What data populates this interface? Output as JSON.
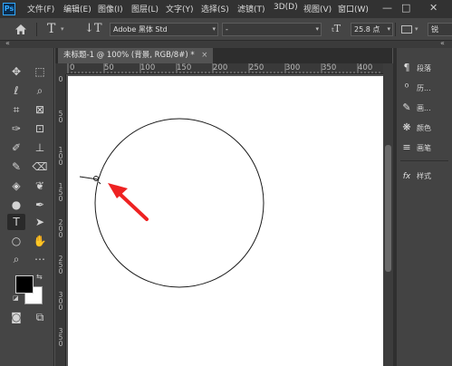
{
  "app": {
    "logo": "Ps"
  },
  "menu": [
    "文件(F)",
    "编辑(E)",
    "图像(I)",
    "图层(L)",
    "文字(Y)",
    "选择(S)",
    "滤镜(T)",
    "3D(D)",
    "视图(V)",
    "窗口(W)"
  ],
  "window_controls": [
    "—",
    "□",
    "✕"
  ],
  "options": {
    "font_family": "Adobe 黑体 Std",
    "font_style": "-",
    "font_size": "25.8 点",
    "antialias": "锐"
  },
  "document": {
    "tab_title": "未标题-1 @ 100% (背景, RGB/8#) *",
    "close": "×"
  },
  "ruler": {
    "h_labels": [
      "0",
      "50",
      "100",
      "150",
      "200",
      "250",
      "300",
      "350",
      "400"
    ],
    "v_labels": [
      "0",
      "5 0",
      "1 0 0",
      "1 5 0",
      "2 0 0",
      "2 5 0",
      "3 0 0",
      "3 5 0"
    ]
  },
  "panels": [
    {
      "icon": "paragraph-icon",
      "glyph": "¶",
      "label": "段落"
    },
    {
      "icon": "history-icon",
      "glyph": "⁰",
      "label": "历..."
    },
    {
      "icon": "brush-preset-icon",
      "glyph": "✎",
      "label": "画..."
    },
    {
      "icon": "swatches-icon",
      "glyph": "❋",
      "label": "颜色"
    },
    {
      "icon": "brush-settings-icon",
      "glyph": "≡",
      "label": "画笔"
    },
    {
      "icon": "styles-icon",
      "glyph": "fx",
      "label": "样式"
    }
  ],
  "colors": {
    "foreground": "#000000",
    "background": "#ffffff",
    "arrow": "#ee2222"
  }
}
